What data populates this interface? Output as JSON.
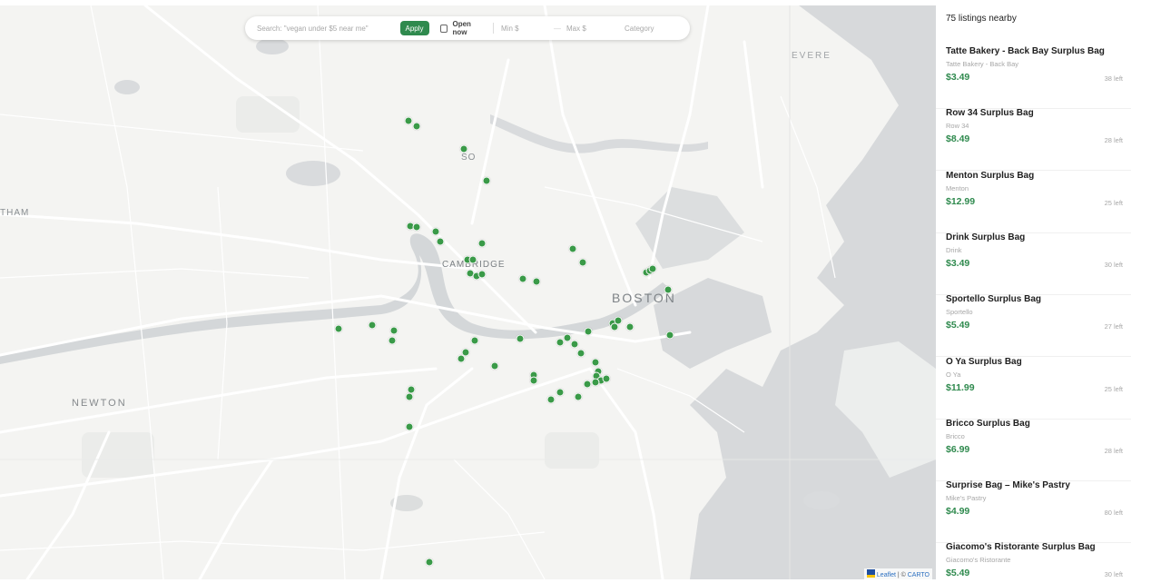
{
  "search": {
    "placeholder": "Search: \"vegan under $5 near me\"",
    "apply_label": "Apply",
    "open_now_label": "Open now",
    "min_placeholder": "Min $",
    "max_placeholder": "Max $",
    "category_placeholder": "Category"
  },
  "map": {
    "labels": {
      "everett": "EVERE",
      "so": "SO",
      "cambridge": "CAMBRIDGE",
      "boston": "BOSTON",
      "newton": "NEWTON",
      "tham": "THAM"
    },
    "attribution": {
      "leaflet": "Leaflet",
      "sep": " | © ",
      "carto": "CARTO"
    },
    "pin_color": "#3a9a48"
  },
  "sidebar": {
    "count_label": "75 listings nearby",
    "listings": [
      {
        "title": "Tatte Bakery - Back Bay Surplus Bag",
        "vendor": "Tatte Bakery - Back Bay",
        "price": "$3.49",
        "left": "38 left"
      },
      {
        "title": "Row 34 Surplus Bag",
        "vendor": "Row 34",
        "price": "$8.49",
        "left": "28 left"
      },
      {
        "title": "Menton Surplus Bag",
        "vendor": "Menton",
        "price": "$12.99",
        "left": "25 left"
      },
      {
        "title": "Drink Surplus Bag",
        "vendor": "Drink",
        "price": "$3.49",
        "left": "30 left"
      },
      {
        "title": "Sportello Surplus Bag",
        "vendor": "Sportello",
        "price": "$5.49",
        "left": "27 left"
      },
      {
        "title": "O Ya Surplus Bag",
        "vendor": "O Ya",
        "price": "$11.99",
        "left": "25 left"
      },
      {
        "title": "Bricco Surplus Bag",
        "vendor": "Bricco",
        "price": "$6.99",
        "left": "28 left"
      },
      {
        "title": "Surprise Bag – Mike's Pastry",
        "vendor": "Mike's Pastry",
        "price": "$4.99",
        "left": "80 left"
      },
      {
        "title": "Giacomo's Ristorante Surplus Bag",
        "vendor": "Giacomo's Ristorante",
        "price": "$5.49",
        "left": "30 left"
      }
    ]
  },
  "colors": {
    "accent": "#2f8a4e",
    "map_bg": "#f4f4f2",
    "water": "#d6d8da"
  }
}
